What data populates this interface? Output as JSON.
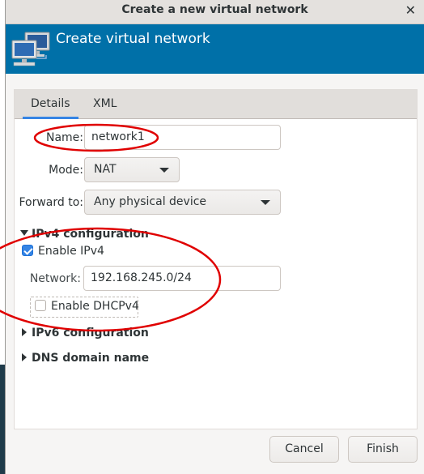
{
  "window": {
    "title": "Create a new virtual network",
    "close_icon": "close-icon"
  },
  "banner": {
    "title": "Create virtual network",
    "icon": "network-computers-icon"
  },
  "tabs": [
    {
      "label": "Details",
      "active": true
    },
    {
      "label": "XML",
      "active": false
    }
  ],
  "form": {
    "name_label": "Name:",
    "name_value": "network1",
    "mode_label": "Mode:",
    "mode_value": "NAT",
    "forward_label": "Forward to:",
    "forward_value": "Any physical device"
  },
  "ipv4": {
    "section_label": "IPv4 configuration",
    "expanded": true,
    "enable_label": "Enable IPv4",
    "enable_checked": true,
    "network_label": "Network:",
    "network_value": "192.168.245.0/24",
    "dhcp_label": "Enable DHCPv4",
    "dhcp_checked": false
  },
  "ipv6": {
    "section_label": "IPv6 configuration",
    "expanded": false
  },
  "dns": {
    "section_label": "DNS domain name",
    "expanded": false
  },
  "buttons": {
    "cancel": "Cancel",
    "finish": "Finish"
  },
  "colors": {
    "banner": "#0070a8",
    "accent": "#3584e4",
    "annotation": "#e00000"
  }
}
